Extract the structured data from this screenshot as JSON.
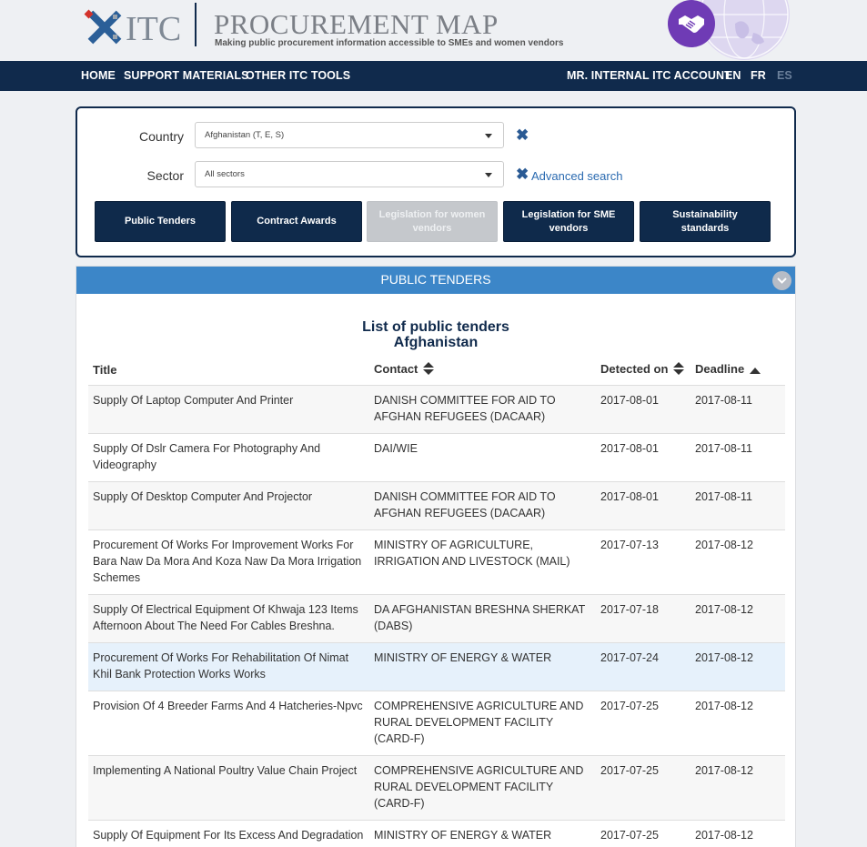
{
  "header": {
    "logo_text": "ITC",
    "title": "PROCUREMENT MAP",
    "subtitle": "Making public procurement information accessible to SMEs and women vendors"
  },
  "nav": {
    "left": [
      "HOME",
      "SUPPORT MATERIALS",
      "OTHER ITC TOOLS"
    ],
    "account": "MR. INTERNAL ITC ACCOUNT",
    "languages": [
      "EN",
      "FR",
      "ES"
    ]
  },
  "search": {
    "country_label": "Country",
    "country_value": "Afghanistan (T, E, S)",
    "sector_label": "Sector",
    "sector_value": "All sectors",
    "advanced_search": "Advanced search",
    "buttons": [
      "Public Tenders",
      "Contract Awards",
      "Legislation for women vendors",
      "Legislation for SME vendors",
      "Sustainability standards"
    ]
  },
  "panel": {
    "header": "PUBLIC TENDERS",
    "list_title": "List of public tenders",
    "list_country": "Afghanistan"
  },
  "table": {
    "columns": [
      "Title",
      "Contact",
      "Detected on",
      "Deadline"
    ],
    "rows": [
      {
        "title": "Supply Of Laptop Computer And Printer",
        "contact": "DANISH COMMITTEE FOR AID TO AFGHAN REFUGEES (DACAAR)",
        "detected": "2017-08-01",
        "deadline": "2017-08-11"
      },
      {
        "title": "Supply Of Dslr Camera For Photography And Videography",
        "contact": "DAI/WIE",
        "detected": "2017-08-01",
        "deadline": "2017-08-11"
      },
      {
        "title": "Supply Of Desktop Computer And Projector",
        "contact": "DANISH COMMITTEE FOR AID TO AFGHAN REFUGEES (DACAAR)",
        "detected": "2017-08-01",
        "deadline": "2017-08-11"
      },
      {
        "title": "Procurement Of Works For Improvement Works For Bara Naw Da Mora And Koza Naw Da Mora Irrigation Schemes",
        "contact": "MINISTRY OF AGRICULTURE, IRRIGATION AND LIVESTOCK (MAIL)",
        "detected": "2017-07-13",
        "deadline": "2017-08-12"
      },
      {
        "title": "Supply Of Electrical Equipment Of Khwaja 123 Items Afternoon About The Need For Cables Breshna.",
        "contact": "DA AFGHANISTAN BRESHNA SHERKAT (DABS)",
        "detected": "2017-07-18",
        "deadline": "2017-08-12"
      },
      {
        "title": "Procurement Of Works For Rehabilitation Of Nimat Khil Bank Protection Works Works",
        "contact": "MINISTRY OF ENERGY & WATER",
        "detected": "2017-07-24",
        "deadline": "2017-08-12"
      },
      {
        "title": "Provision Of 4 Breeder Farms And 4 Hatcheries-Npvc",
        "contact": "COMPREHENSIVE AGRICULTURE AND RURAL DEVELOPMENT FACILITY (CARD-F)",
        "detected": "2017-07-25",
        "deadline": "2017-08-12"
      },
      {
        "title": "Implementing A National Poultry Value Chain Project",
        "contact": "COMPREHENSIVE AGRICULTURE AND RURAL DEVELOPMENT FACILITY (CARD-F)",
        "detected": "2017-07-25",
        "deadline": "2017-08-12"
      },
      {
        "title": "Supply Of Equipment For Its Excess And Degradation",
        "contact": "MINISTRY OF ENERGY & WATER",
        "detected": "2017-07-25",
        "deadline": "2017-08-12"
      }
    ]
  },
  "colors": {
    "navy": "#102a4c",
    "panel_blue": "#3c86c8",
    "link_blue": "#2a6ab0",
    "purple": "#6f3bb5"
  }
}
